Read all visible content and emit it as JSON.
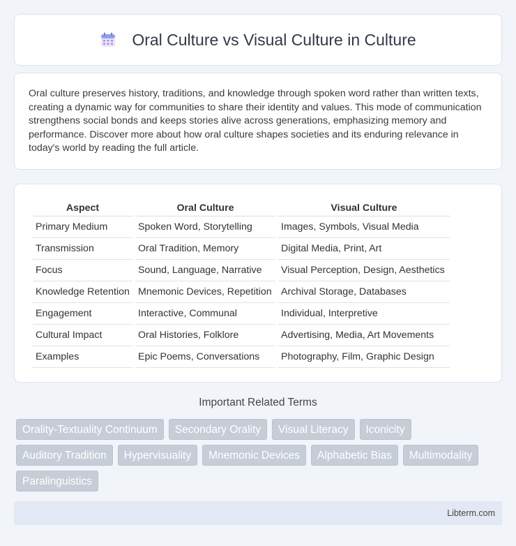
{
  "header": {
    "title": "Oral Culture vs Visual Culture in Culture",
    "icon": "calendar-icon"
  },
  "intro": {
    "text": "Oral culture preserves history, traditions, and knowledge through spoken word rather than written texts, creating a dynamic way for communities to share their identity and values. This mode of communication strengthens social bonds and keeps stories alive across generations, emphasizing memory and performance. Discover more about how oral culture shapes societies and its enduring relevance in today's world by reading the full article."
  },
  "table": {
    "headers": [
      "Aspect",
      "Oral Culture",
      "Visual Culture"
    ],
    "rows": [
      [
        "Primary Medium",
        "Spoken Word, Storytelling",
        "Images, Symbols, Visual Media"
      ],
      [
        "Transmission",
        "Oral Tradition, Memory",
        "Digital Media, Print, Art"
      ],
      [
        "Focus",
        "Sound, Language, Narrative",
        "Visual Perception, Design, Aesthetics"
      ],
      [
        "Knowledge Retention",
        "Mnemonic Devices, Repetition",
        "Archival Storage, Databases"
      ],
      [
        "Engagement",
        "Interactive, Communal",
        "Individual, Interpretive"
      ],
      [
        "Cultural Impact",
        "Oral Histories, Folklore",
        "Advertising, Media, Art Movements"
      ],
      [
        "Examples",
        "Epic Poems, Conversations",
        "Photography, Film, Graphic Design"
      ]
    ]
  },
  "related": {
    "title": "Important Related Terms",
    "tags": [
      "Orality-Textuality Continuum",
      "Secondary Orality",
      "Visual Literacy",
      "Iconicity",
      "Auditory Tradition",
      "Hypervisuality",
      "Mnemonic Devices",
      "Alphabetic Bias",
      "Multimodality",
      "Paralinguistics"
    ]
  },
  "footer": {
    "text": "Libterm.com"
  },
  "colors": {
    "accent": "#7b6fd6",
    "tag_bg": "#c7cdd7"
  }
}
